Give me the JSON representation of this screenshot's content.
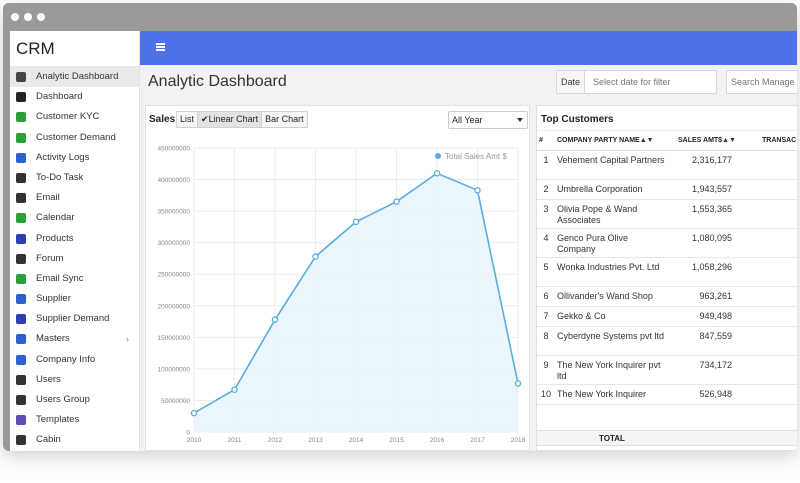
{
  "app": {
    "brand": "CRM"
  },
  "sidebar": {
    "items": [
      {
        "label": "Analytic Dashboard",
        "icon": "dashboard-icon",
        "color": "#444444",
        "active": true
      },
      {
        "label": "Dashboard",
        "icon": "dashboard-icon",
        "color": "#222222"
      },
      {
        "label": "Customer KYC",
        "icon": "book-icon",
        "color": "#2e9e3a"
      },
      {
        "label": "Customer Demand",
        "icon": "demand-icon",
        "color": "#2e9e3a"
      },
      {
        "label": "Activity Logs",
        "icon": "list-icon",
        "color": "#2f5fd1"
      },
      {
        "label": "To-Do Task",
        "icon": "checklist-icon",
        "color": "#333333"
      },
      {
        "label": "Email",
        "icon": "email-icon",
        "color": "#333333"
      },
      {
        "label": "Calendar",
        "icon": "calendar-icon",
        "color": "#2e9e3a"
      },
      {
        "label": "Products",
        "icon": "cart-icon",
        "color": "#2f3db0"
      },
      {
        "label": "Forum",
        "icon": "forum-icon",
        "color": "#333333"
      },
      {
        "label": "Email Sync",
        "icon": "email-sync-icon",
        "color": "#2e9e3a"
      },
      {
        "label": "Supplier",
        "icon": "truck-icon",
        "color": "#2f5fd1"
      },
      {
        "label": "Supplier Demand",
        "icon": "grid-icon",
        "color": "#2f3db0"
      },
      {
        "label": "Masters",
        "icon": "layers-icon",
        "color": "#2f5fd1",
        "chevron": "›"
      },
      {
        "label": "Company Info",
        "icon": "info-icon",
        "color": "#2f5fd1"
      },
      {
        "label": "Users",
        "icon": "users-icon",
        "color": "#333333"
      },
      {
        "label": "Users Group",
        "icon": "users-group-icon",
        "color": "#333333"
      },
      {
        "label": "Templates",
        "icon": "templates-icon",
        "color": "#5a4fb0"
      },
      {
        "label": "Cabin",
        "icon": "cabin-icon",
        "color": "#333333"
      }
    ]
  },
  "header": {
    "accent": "#4f72e8"
  },
  "page": {
    "title": "Analytic Dashboard"
  },
  "filters": {
    "date_label": "Date",
    "date_placeholder": "Select date for filter",
    "search_placeholder": "Search Manage"
  },
  "sales": {
    "title": "Sales",
    "views": [
      "List",
      "Linear Chart",
      "Bar Chart"
    ],
    "active_view": "Linear Chart",
    "year_select": "All Year"
  },
  "chart_data": {
    "type": "area",
    "x": [
      "2010",
      "2011",
      "2012",
      "2013",
      "2014",
      "2015",
      "2016",
      "2017",
      "2018"
    ],
    "series": [
      {
        "name": "Total Sales Amt $",
        "values": [
          30000000,
          67000000,
          178000000,
          278000000,
          333000000,
          365000000,
          410000000,
          383000000,
          77000000
        ],
        "color": "#5aaedc"
      }
    ],
    "ylim": [
      0,
      450000000
    ],
    "yticks": [
      "0",
      "50000000",
      "100000000",
      "150000000",
      "200000000",
      "250000000",
      "300000000",
      "350000000",
      "400000000",
      "450000000"
    ],
    "grid": true,
    "legend": "top-right"
  },
  "customers": {
    "title": "Top Customers",
    "columns": [
      "#",
      "COMPANY PARTY NAME",
      "SALES AMT$",
      "TRANSAC"
    ],
    "rows": [
      {
        "num": "1",
        "name": "Vehement Capital Partners",
        "amount": "2,316,177"
      },
      {
        "num": "2",
        "name": "Umbrella Corporation",
        "amount": "1,943,557"
      },
      {
        "num": "3",
        "name": "Olivia Pope & Wand Associates",
        "amount": "1,553,365"
      },
      {
        "num": "4",
        "name": "Genco Pura Olive Company",
        "amount": "1,080,095"
      },
      {
        "num": "5",
        "name": "Wonka Industries Pvt. Ltd",
        "amount": "1,058,296"
      },
      {
        "num": "6",
        "name": "Ollivander's Wand Shop",
        "amount": "963,261"
      },
      {
        "num": "7",
        "name": "Gekko & Co",
        "amount": "949,498"
      },
      {
        "num": "8",
        "name": "Cyberdyne Systems pvt ltd",
        "amount": "847,559"
      },
      {
        "num": "9",
        "name": "The New York Inquirer pvt ltd",
        "amount": "734,172"
      },
      {
        "num": "10",
        "name": "The New York Inquirer",
        "amount": "526,948"
      }
    ],
    "total_label": "TOTAL"
  }
}
